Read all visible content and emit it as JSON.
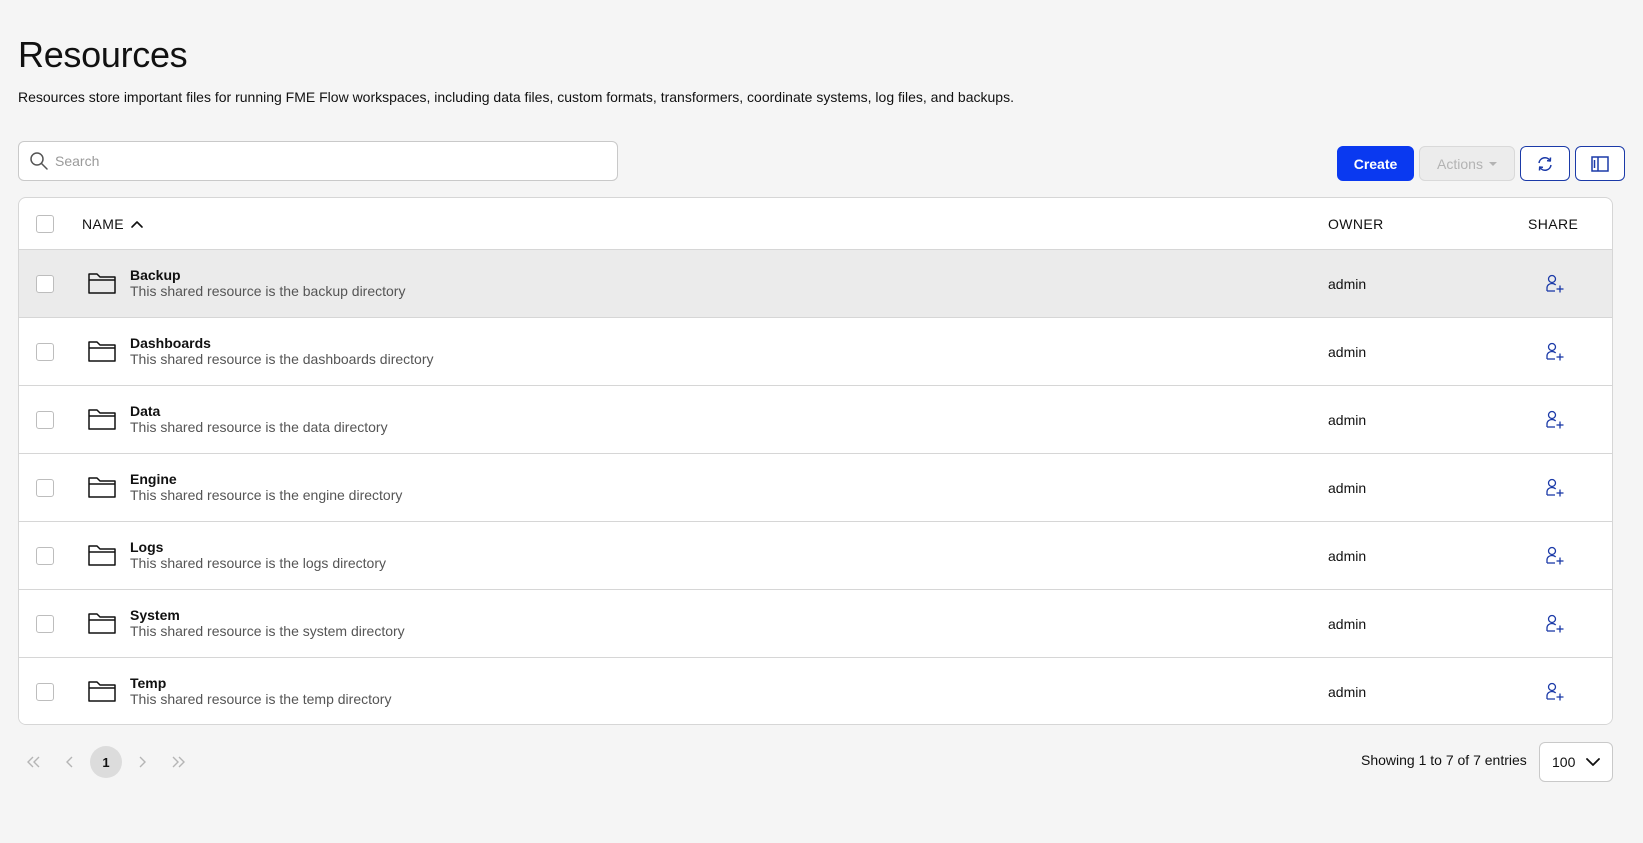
{
  "page": {
    "title": "Resources",
    "subtitle": "Resources store important files for running FME Flow workspaces, including data files, custom formats, transformers, coordinate systems, log files, and backups."
  },
  "search": {
    "placeholder": "Search",
    "value": ""
  },
  "toolbar": {
    "create_label": "Create",
    "actions_label": "Actions",
    "refresh_icon": "refresh-icon",
    "columns_icon": "columns-panel-icon"
  },
  "colors": {
    "primary": "#0a39f0",
    "border": "#d6d6d6",
    "selected_row": "#ebebeb",
    "background": "#f5f5f5"
  },
  "table": {
    "columns": {
      "name": "NAME",
      "owner": "OWNER",
      "share": "SHARE"
    },
    "sort": {
      "column": "NAME",
      "direction": "ascending"
    },
    "rows": [
      {
        "name": "Backup",
        "description": "This shared resource is the backup directory",
        "owner": "admin",
        "icon": "folder-icon",
        "highlighted": true
      },
      {
        "name": "Dashboards",
        "description": "This shared resource is the dashboards directory",
        "owner": "admin",
        "icon": "folder-icon",
        "highlighted": false
      },
      {
        "name": "Data",
        "description": "This shared resource is the data directory",
        "owner": "admin",
        "icon": "folder-icon",
        "highlighted": false
      },
      {
        "name": "Engine",
        "description": "This shared resource is the engine directory",
        "owner": "admin",
        "icon": "folder-icon",
        "highlighted": false
      },
      {
        "name": "Logs",
        "description": "This shared resource is the logs directory",
        "owner": "admin",
        "icon": "folder-icon",
        "highlighted": false
      },
      {
        "name": "System",
        "description": "This shared resource is the system directory",
        "owner": "admin",
        "icon": "folder-icon",
        "highlighted": false
      },
      {
        "name": "Temp",
        "description": "This shared resource is the temp directory",
        "owner": "admin",
        "icon": "folder-icon",
        "highlighted": false
      }
    ]
  },
  "pagination": {
    "current_page": "1",
    "entries_text": "Showing 1 to 7 of 7 entries",
    "page_size": "100"
  }
}
